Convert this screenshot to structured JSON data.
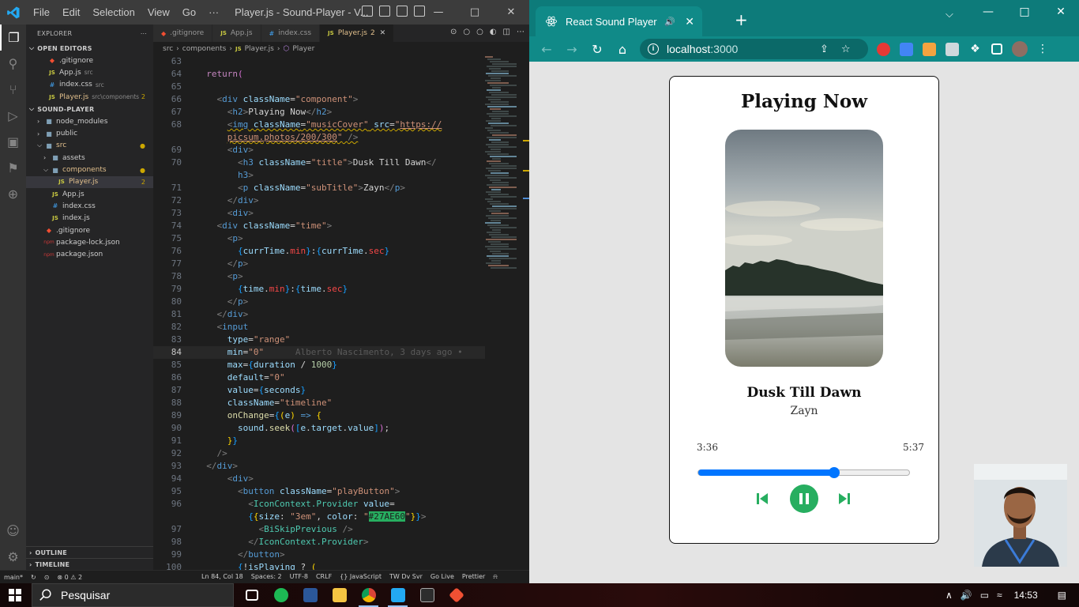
{
  "vscode": {
    "menu": [
      "File",
      "Edit",
      "Selection",
      "View",
      "Go",
      "···"
    ],
    "window_title": "Player.js - Sound-Player - V...",
    "explorer_title": "EXPLORER",
    "open_editors_label": "OPEN EDITORS",
    "open_editors": [
      {
        "name": ".gitignore",
        "desc": "",
        "icon": "git-icon",
        "modified": ""
      },
      {
        "name": "App.js",
        "desc": "src",
        "icon": "js-icon",
        "modified": ""
      },
      {
        "name": "index.css",
        "desc": "src",
        "icon": "css-icon",
        "modified": ""
      },
      {
        "name": "Player.js",
        "desc": "src\\components",
        "icon": "js-icon",
        "modified": "2"
      }
    ],
    "project_label": "SOUND-PLAYER",
    "tree": [
      {
        "name": "node_modules",
        "icon": "folder-icon",
        "indent": 1,
        "mod": ""
      },
      {
        "name": "public",
        "icon": "folder-icon",
        "indent": 1,
        "mod": ""
      },
      {
        "name": "src",
        "icon": "folder-icon",
        "indent": 1,
        "mod": "●"
      },
      {
        "name": "assets",
        "icon": "folder-icon",
        "indent": 2,
        "mod": ""
      },
      {
        "name": "components",
        "icon": "folder-icon",
        "indent": 2,
        "mod": "●"
      },
      {
        "name": "Player.js",
        "icon": "js-icon",
        "indent": 3,
        "mod": "2"
      },
      {
        "name": "App.js",
        "icon": "js-icon",
        "indent": 2,
        "mod": ""
      },
      {
        "name": "index.css",
        "icon": "css-icon",
        "indent": 2,
        "mod": ""
      },
      {
        "name": "index.js",
        "icon": "js-icon",
        "indent": 2,
        "mod": ""
      },
      {
        "name": ".gitignore",
        "icon": "git-icon",
        "indent": 1,
        "mod": ""
      },
      {
        "name": "package-lock.json",
        "icon": "npm-icon",
        "indent": 1,
        "mod": ""
      },
      {
        "name": "package.json",
        "icon": "npm-icon",
        "indent": 1,
        "mod": ""
      }
    ],
    "outline_label": "OUTLINE",
    "timeline_label": "TIMELINE",
    "tabs": [
      {
        "label": ".gitignore",
        "icon": "git"
      },
      {
        "label": "App.js",
        "icon": "js"
      },
      {
        "label": "index.css",
        "icon": "css"
      },
      {
        "label": "Player.js",
        "icon": "js",
        "count": "2",
        "active": true
      }
    ],
    "breadcrumb": [
      "src",
      "components",
      "Player.js",
      "Player"
    ],
    "blame": "Alberto Nascimento, 3 days ago •",
    "status": {
      "branch": "main*",
      "errors": "⊗ 0 ⚠ 2",
      "position": "Ln 84, Col 18",
      "spaces": "Spaces: 2",
      "encoding": "UTF-8",
      "eol": "CRLF",
      "language": "{} JavaScript",
      "tw": "TW Dv Svr",
      "golive": "Go Live",
      "prettier": "Prettier"
    }
  },
  "browser": {
    "tab_title": "React Sound Player",
    "url_host": "localhost",
    "url_port": ":3000",
    "player": {
      "heading": "Playing Now",
      "title": "Dusk Till Dawn",
      "artist": "Zayn",
      "current_time": "3:36",
      "total_time": "5:37",
      "progress": 0.64,
      "accent_color": "#27AE60"
    }
  },
  "taskbar": {
    "search_placeholder": "Pesquisar",
    "clock": "14:53"
  }
}
